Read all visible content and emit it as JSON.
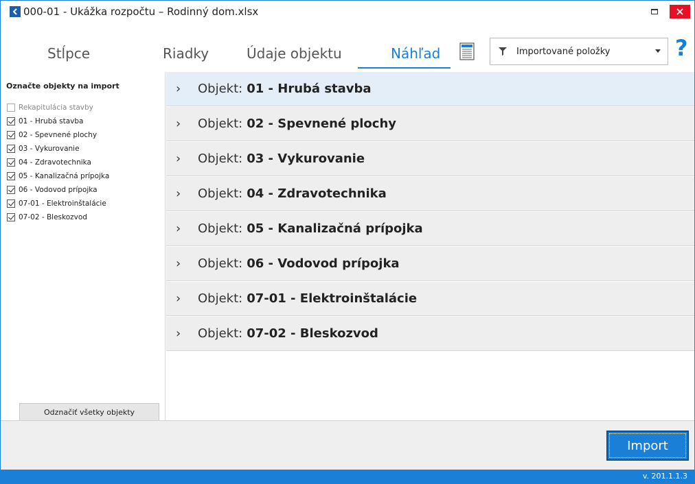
{
  "window": {
    "title": "000-01 - Ukážka rozpočtu – Rodinný dom.xlsx",
    "accent": "#1a7fd6",
    "close_color": "#e81123"
  },
  "tabs": [
    {
      "label": "Stĺpce",
      "active": false
    },
    {
      "label": "Riadky",
      "active": false
    },
    {
      "label": "Údaje objektu",
      "active": false
    },
    {
      "label": "Náhľad",
      "active": true
    }
  ],
  "filter": {
    "selected": "Importované položky"
  },
  "help": {
    "label": "?"
  },
  "left": {
    "heading": "Označte objekty na import",
    "items": [
      {
        "label": "Rekapitulácia stavby",
        "checked": false,
        "disabled": true
      },
      {
        "label": "01 - Hrubá stavba",
        "checked": true
      },
      {
        "label": "02 - Spevnené plochy",
        "checked": true
      },
      {
        "label": "03 - Vykurovanie",
        "checked": true
      },
      {
        "label": "04 - Zdravotechnika",
        "checked": true
      },
      {
        "label": "05 - Kanalizačná prípojka",
        "checked": true
      },
      {
        "label": "06 - Vodovod prípojka",
        "checked": true
      },
      {
        "label": "07-01 - Elektroinštalácie",
        "checked": true
      },
      {
        "label": "07-02 - Bleskozvod",
        "checked": true
      }
    ],
    "uncheck_all_label": "Odznačiť všetky objekty"
  },
  "objects": {
    "prefix": "Objekt:",
    "items": [
      {
        "name": "01 - Hrubá stavba",
        "selected": true
      },
      {
        "name": "02 - Spevnené plochy",
        "selected": false
      },
      {
        "name": "03 - Vykurovanie",
        "selected": false
      },
      {
        "name": "04 - Zdravotechnika",
        "selected": false
      },
      {
        "name": "05 - Kanalizačná prípojka",
        "selected": false
      },
      {
        "name": "06 - Vodovod prípojka",
        "selected": false
      },
      {
        "name": "07-01 - Elektroinštalácie",
        "selected": false
      },
      {
        "name": "07-02 - Bleskozvod",
        "selected": false
      }
    ]
  },
  "footer": {
    "import_label": "Import",
    "version": "v. 201.1.1.3"
  }
}
